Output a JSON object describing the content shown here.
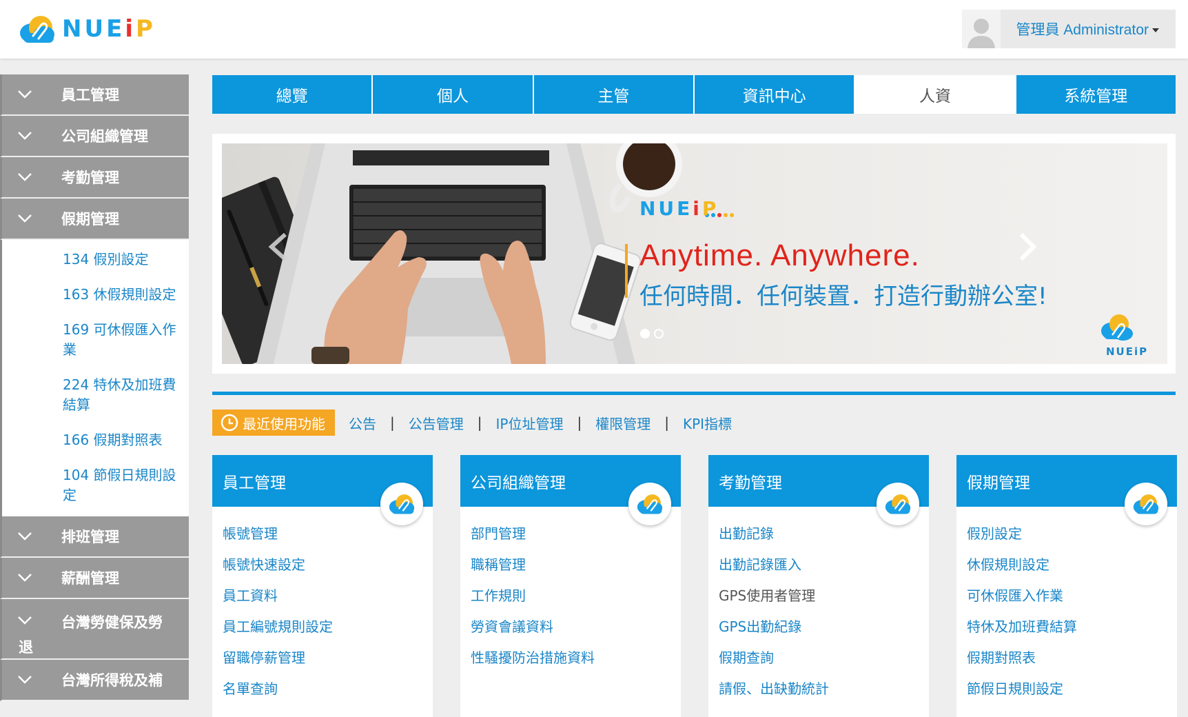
{
  "header": {
    "logo_text": "NUEiP",
    "user_label": "管理員 Administrator"
  },
  "colors": {
    "primary": "#0c96dc",
    "link": "#1a86c8",
    "accent_orange": "#f5a623",
    "sidebar_gray": "#9a9a9a"
  },
  "sidebar": {
    "categories_top": [
      "員工管理",
      "公司組織管理",
      "考勤管理",
      "假期管理"
    ],
    "sub_items": [
      {
        "code": "134",
        "label": "假別設定"
      },
      {
        "code": "163",
        "label": "休假規則設定"
      },
      {
        "code": "169",
        "label": "可休假匯入作",
        "wrap": "業"
      },
      {
        "code": "224",
        "label": "特休及加班費",
        "wrap": "結算"
      },
      {
        "code": "166",
        "label": "假期對照表"
      },
      {
        "code": "104",
        "label": "節假日規則設",
        "wrap": "定"
      }
    ],
    "categories_bottom": [
      "排班管理",
      "薪酬管理"
    ],
    "tall_category": {
      "line1": "台灣勞健保及勞",
      "line2": "退"
    },
    "cut_category": "台灣所得稅及補"
  },
  "tabs": [
    "總覽",
    "個人",
    "主管",
    "資訊中心",
    "人資",
    "系統管理"
  ],
  "active_tab": "人資",
  "banner": {
    "brand": "NUEiP",
    "headline": "Anytime. Anywhere.",
    "subline": "任何時間．任何裝置．打造行動辦公室!",
    "corner_logo_text": "NUEiP"
  },
  "quick": {
    "recent_label": "最近使用功能",
    "links": [
      "公告",
      "公告管理",
      "IP位址管理",
      "權限管理",
      "KPI指標"
    ],
    "separator": "|"
  },
  "cards": [
    {
      "title": "員工管理",
      "items": [
        "帳號管理",
        "帳號快速設定",
        "員工資料",
        "員工編號規則設定",
        "留職停薪管理",
        "名單查詢"
      ]
    },
    {
      "title": "公司組織管理",
      "items": [
        "部門管理",
        "職稱管理",
        "工作規則",
        "勞資會議資料",
        "性騷擾防治措施資料"
      ]
    },
    {
      "title": "考勤管理",
      "items": [
        "出勤記錄",
        "出勤記錄匯入",
        "GPS使用者管理",
        "GPS出勤紀錄",
        "假期查詢",
        "請假、出缺勤統計"
      ]
    },
    {
      "title": "假期管理",
      "items": [
        "假別設定",
        "休假規則設定",
        "可休假匯入作業",
        "特休及加班費結算",
        "假期對照表",
        "節假日規則設定"
      ]
    }
  ]
}
